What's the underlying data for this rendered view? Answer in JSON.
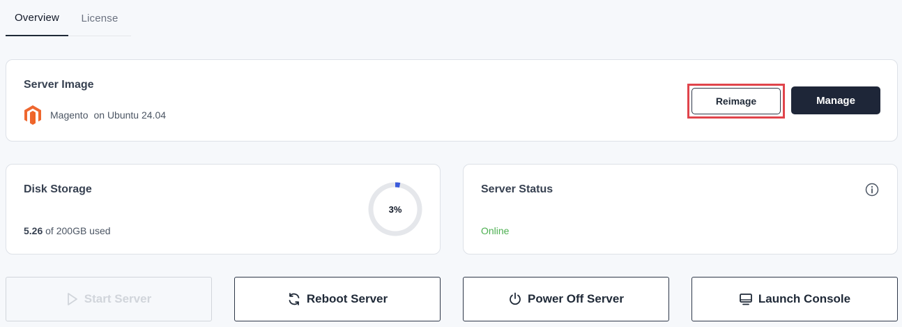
{
  "tabs": [
    {
      "label": "Overview",
      "active": true
    },
    {
      "label": "License",
      "active": false
    }
  ],
  "server_image": {
    "title": "Server Image",
    "app_name": "Magento",
    "os_text": "on Ubuntu 24.04",
    "reimage_label": "Reimage",
    "manage_label": "Manage",
    "logo_icon": "magento-logo",
    "logo_color": "#ee672f"
  },
  "disk_storage": {
    "title": "Disk Storage",
    "used": "5.26",
    "total_text": "of 200GB used",
    "percent_label": "3%",
    "percent_value": 3,
    "accent_color": "#3b5bdb"
  },
  "server_status": {
    "title": "Server Status",
    "status": "Online",
    "status_color": "#4caf50",
    "info_icon": "info-icon"
  },
  "actions": {
    "start_label": "Start Server",
    "start_disabled": true,
    "reboot_label": "Reboot Server",
    "power_off_label": "Power Off Server",
    "console_label": "Launch Console"
  }
}
